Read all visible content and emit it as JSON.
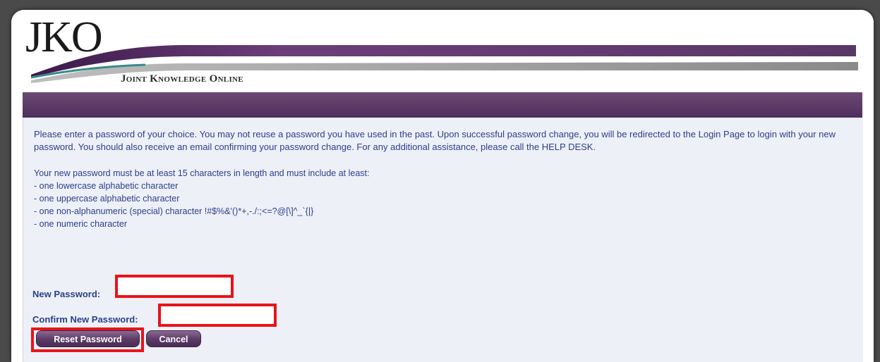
{
  "header": {
    "logo_text": "JKO",
    "subtitle": "Joint Knowledge Online"
  },
  "instructions": {
    "intro": "Please enter a password of your choice. You may not reuse a password you have used in the past. Upon successful password change, you will be redirected to the Login Page to login with your new password. You should also receive an email confirming your password change. For any additional assistance, please call the HELP DESK.",
    "requirements_intro": "Your new password must be at least 15 characters in length and must include at least:",
    "requirements": [
      "- one lowercase alphabetic character",
      "- one uppercase alphabetic character",
      "- one non-alphanumeric (special) character !#$%&'()*+,-./:;<=?@[\\]^_`{|}",
      "- one numeric character"
    ]
  },
  "form": {
    "new_password_label": "New Password:",
    "new_password_value": "",
    "confirm_password_label": "Confirm New Password:",
    "confirm_password_value": "",
    "reset_button": "Reset Password",
    "cancel_button": "Cancel"
  },
  "colors": {
    "accent": "#5a3866",
    "text": "#2a3f8c",
    "highlight": "#e8141a",
    "swoosh_teal": "#3a8a8a"
  }
}
